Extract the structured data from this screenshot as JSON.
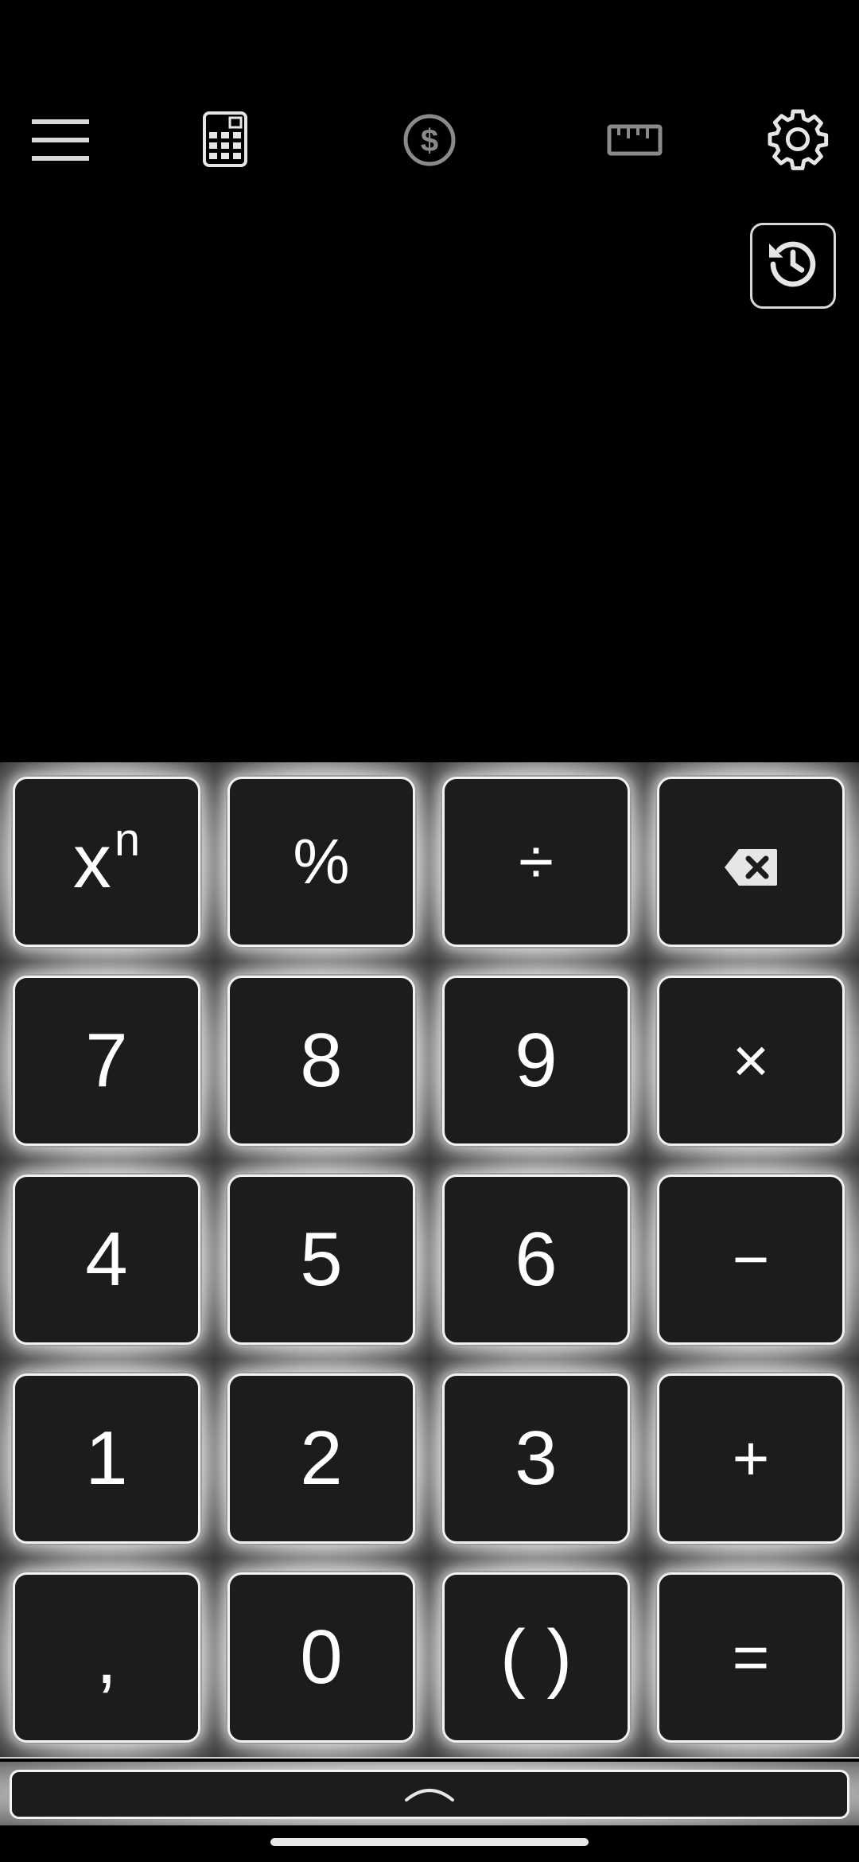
{
  "toolbar": {
    "icons": [
      "menu-icon",
      "calculator-icon",
      "currency-icon",
      "ruler-icon",
      "gear-icon"
    ],
    "colors": {
      "active": "#ffffff",
      "inactive": "#8a8a8a"
    }
  },
  "history": {
    "icon": "history-icon"
  },
  "display": {
    "expression": ""
  },
  "keypad": {
    "power_base": "x",
    "power_exp": "n",
    "percent": "%",
    "divide": "÷",
    "backspace_icon": "backspace-icon",
    "seven": "7",
    "eight": "8",
    "nine": "9",
    "multiply": "×",
    "four": "4",
    "five": "5",
    "six": "6",
    "minus": "−",
    "one": "1",
    "two": "2",
    "three": "3",
    "plus": "+",
    "comma": ",",
    "zero": "0",
    "parens": "( )",
    "equals": "="
  },
  "expand": {
    "icon": "chevron-up-icon"
  }
}
